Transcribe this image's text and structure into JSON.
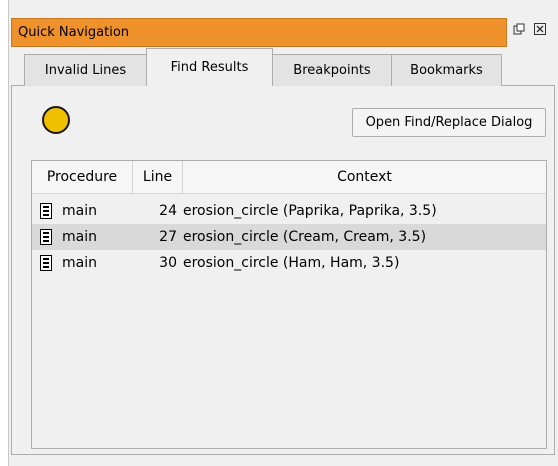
{
  "window": {
    "title": "Quick Navigation",
    "controls": [
      "float-icon",
      "close-icon"
    ]
  },
  "tabs": [
    {
      "label": "Invalid Lines",
      "active": false
    },
    {
      "label": "Find Results",
      "active": true
    },
    {
      "label": "Breakpoints",
      "active": false
    },
    {
      "label": "Bookmarks",
      "active": false
    }
  ],
  "find_results": {
    "status_color": "#f0c000",
    "open_dialog_label": "Open Find/Replace Dialog",
    "columns": [
      "Procedure",
      "Line",
      "Context"
    ],
    "rows": [
      {
        "procedure": "main",
        "line": "24",
        "context": "erosion_circle (Paprika, Paprika, 3.5)",
        "selected": false,
        "icon": "procedure-icon"
      },
      {
        "procedure": "main",
        "line": "27",
        "context": "erosion_circle (Cream, Cream, 3.5)",
        "selected": true,
        "icon": "procedure-icon"
      },
      {
        "procedure": "main",
        "line": "30",
        "context": "erosion_circle (Ham, Ham, 3.5)",
        "selected": false,
        "icon": "procedure-icon"
      }
    ]
  },
  "colors": {
    "title_bar": "#f0922b",
    "selected_row": "#d9d9d9"
  }
}
